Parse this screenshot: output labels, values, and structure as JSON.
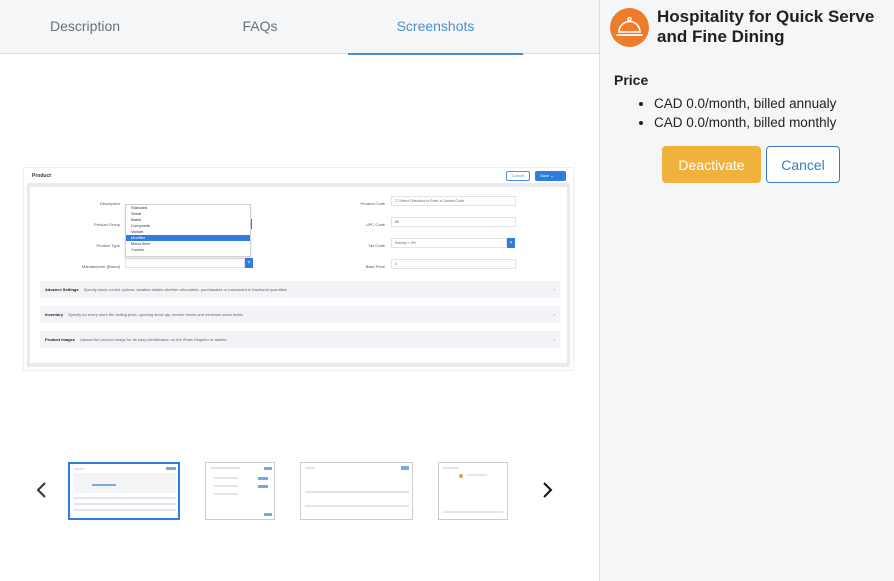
{
  "tabs": [
    {
      "label": "Description",
      "active": false
    },
    {
      "label": "FAQs",
      "active": false
    },
    {
      "label": "Screenshots",
      "active": true
    }
  ],
  "screenshot": {
    "title": "Product",
    "cancel_label": "Cancel",
    "save_label": "Save",
    "fields": {
      "description": "Description",
      "product_group": "Product Group",
      "product_type": "Product Type",
      "manufacturer": "Manufacturer (Brand)",
      "product_code": "Product Code",
      "product_code_hint": "Select Checkbox to Enter a Custom Code",
      "upc_code": "UPC Code",
      "upc_value": "88",
      "tax_code": "Tax Code",
      "tax_value": "Exempt = 0%",
      "base_price": "Base Price",
      "base_price_value": "0"
    },
    "dropdown_options": [
      "Standard",
      "Serial",
      "Batch",
      "Composite",
      "Variant",
      "Modifier",
      "Menu Item",
      "Combo"
    ],
    "dropdown_selected": "Modifier",
    "sections": [
      {
        "title": "Advance Settings",
        "desc": "Specify stock control options, taxation details whether refundable, purchasable or transacted in fractional quantities"
      },
      {
        "title": "Inventory",
        "desc": "Specify for every store the selling price, opening stock qty, reorder levels and minimum stock levels"
      },
      {
        "title": "Product Images",
        "desc": "Upload the product image for its easy identification on the iPads Register or tablets"
      }
    ]
  },
  "carousel": {
    "thumb_count": 4,
    "active_index": 0
  },
  "product": {
    "title": "Hospitality for Quick Serve and Fine Dining",
    "price_label": "Price",
    "prices": [
      "CAD 0.0/month, billed annualy",
      "CAD 0.0/month, billed monthly"
    ]
  },
  "actions": {
    "deactivate_label": "Deactivate",
    "cancel_label": "Cancel"
  },
  "colors": {
    "accent_blue": "#4a90c8",
    "deactivate_yellow": "#efb23d",
    "logo_orange": "#ee7d2b"
  }
}
